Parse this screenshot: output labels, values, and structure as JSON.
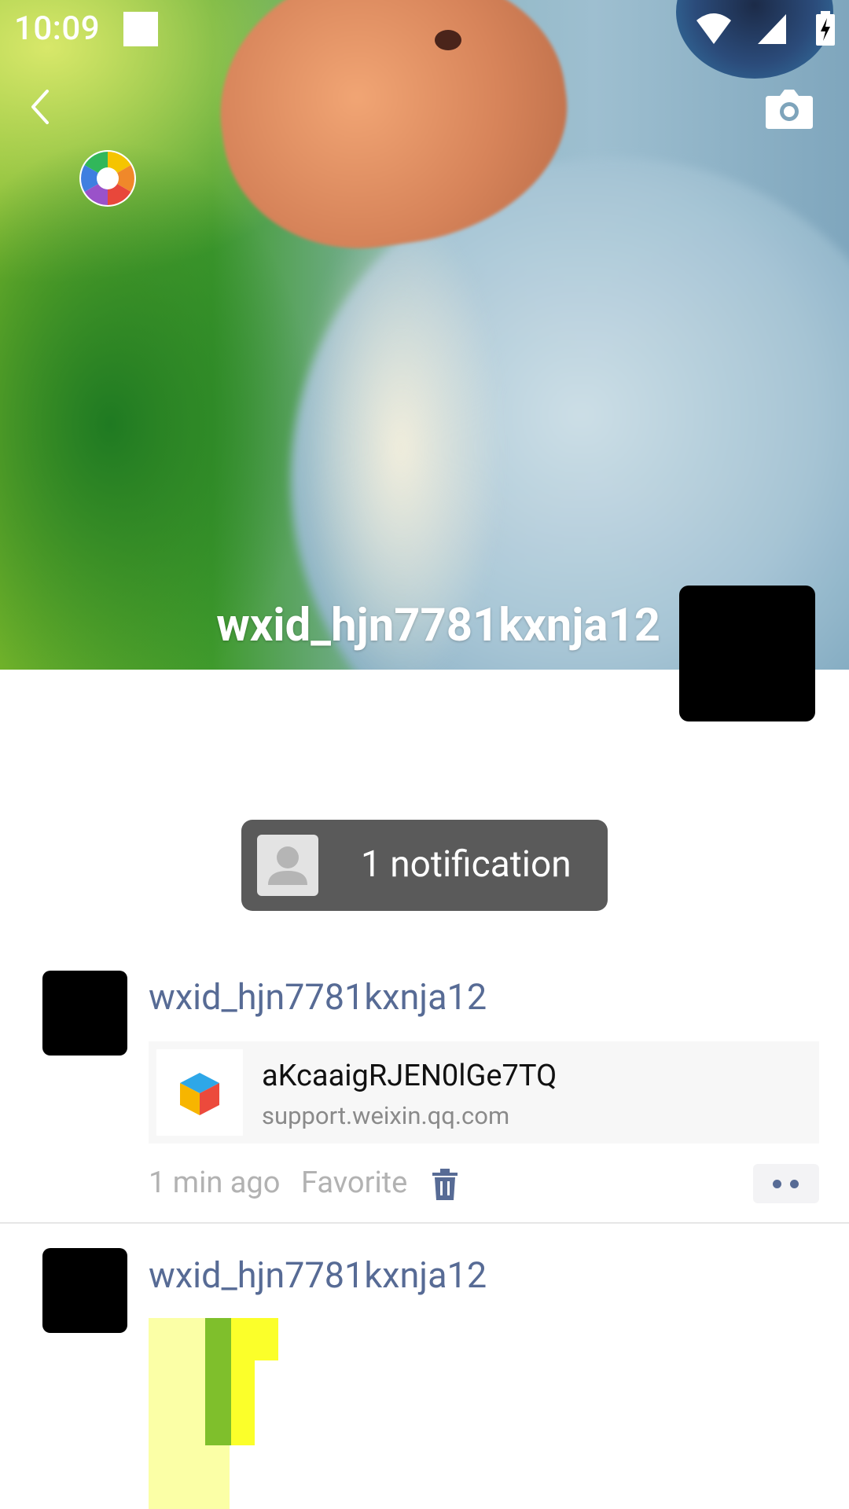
{
  "status_bar": {
    "time": "10:09"
  },
  "cover": {
    "username": "wxid_hjn7781kxnja12"
  },
  "notification": {
    "text": "1 notification"
  },
  "posts": [
    {
      "author": "wxid_hjn7781kxnja12",
      "link": {
        "title": "aKcaaigRJEN0lGe7TQ",
        "domain": "support.weixin.qq.com"
      },
      "time": "1 min ago",
      "favorite_label": "Favorite"
    },
    {
      "author": "wxid_hjn7781kxnja12"
    }
  ],
  "colors": {
    "link_blue": "#576b95",
    "meta_gray": "#b2b2b2",
    "notification_bg": "#5a5a5a"
  },
  "icons": {
    "back": "back-arrow-icon",
    "camera": "camera-icon",
    "album": "album-aperture-icon",
    "delete": "trash-icon",
    "more": "more-dots-icon"
  }
}
